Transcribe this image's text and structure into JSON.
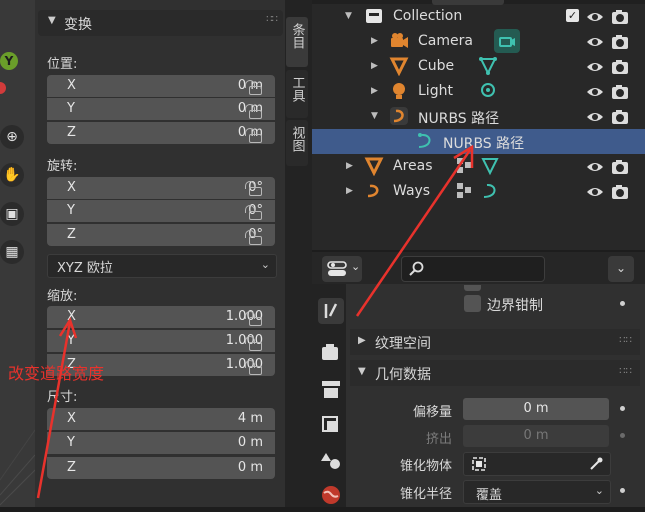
{
  "n_panel": {
    "section_title": "变换",
    "location": {
      "label": "位置:",
      "fields": [
        {
          "axis": "X",
          "value": "0 m"
        },
        {
          "axis": "Y",
          "value": "0 m"
        },
        {
          "axis": "Z",
          "value": "0 m"
        }
      ]
    },
    "rotation": {
      "label": "旋转:",
      "fields": [
        {
          "axis": "X",
          "value": "0°"
        },
        {
          "axis": "Y",
          "value": "0°"
        },
        {
          "axis": "Z",
          "value": "0°"
        }
      ],
      "mode": "XYZ 欧拉"
    },
    "scale": {
      "label": "缩放:",
      "fields": [
        {
          "axis": "X",
          "value": "1.000"
        },
        {
          "axis": "Y",
          "value": "1.000"
        },
        {
          "axis": "Z",
          "value": "1.000"
        }
      ]
    },
    "dimensions": {
      "label": "尺寸:",
      "fields": [
        {
          "axis": "X",
          "value": "4 m"
        },
        {
          "axis": "Y",
          "value": "0 m"
        },
        {
          "axis": "Z",
          "value": "0 m"
        }
      ]
    }
  },
  "vertical_tabs": [
    "条目",
    "工具",
    "视图"
  ],
  "outliner": {
    "rows": [
      {
        "name": "Collection"
      },
      {
        "name": "Camera"
      },
      {
        "name": "Cube"
      },
      {
        "name": "Light"
      },
      {
        "name": "NURBS 路径"
      },
      {
        "name": "NURBS 路径"
      },
      {
        "name": "Areas"
      },
      {
        "name": "Ways"
      }
    ]
  },
  "properties": {
    "search_placeholder": "",
    "clamp_label": "边界钳制",
    "texture_space_label": "纹理空间",
    "geometry_label": "几何数据",
    "offset": {
      "label": "偏移量",
      "value": "0 m"
    },
    "extrude": {
      "label": "挤出",
      "value": "0 m"
    },
    "taper_object_label": "锥化物体",
    "taper_radius": {
      "label": "锥化半径",
      "value": "覆盖"
    }
  },
  "annotation": {
    "text": "改变道路宽度",
    "color": "#e8322c"
  },
  "colors": {
    "selection": "#3f5b8c",
    "accent_orange": "#e0852f",
    "accent_teal": "#3fc1b0"
  }
}
